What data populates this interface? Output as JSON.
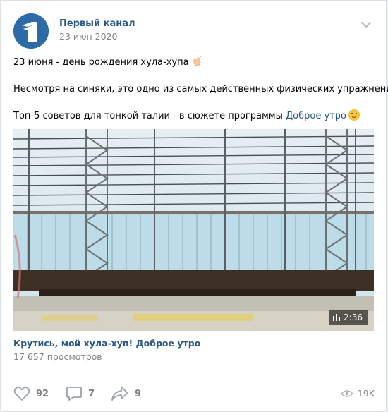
{
  "post": {
    "author": "Первый канал",
    "date": "23 июн 2020",
    "lines": [
      "23 июня - день рождения хула-хупа",
      "Несмотря на синяки, это одно из самых действенных физических упражнений.",
      "Топ-5 советов для тонкой талии - в сюжете программы"
    ],
    "link_text": "Доброе утро",
    "emojis": [
      "clapping-hands-icon",
      "winking-face-icon"
    ]
  },
  "video": {
    "duration": "2:36",
    "title": "Крутись, мой хула-хуп! Доброе утро",
    "views": "17 657 просмотров"
  },
  "actions": {
    "likes": "92",
    "comments": "7",
    "shares": "9",
    "views": "19K"
  },
  "colors": {
    "link": "#2a5885",
    "secondary": "#828282",
    "avatar": "#2c6ba8"
  }
}
